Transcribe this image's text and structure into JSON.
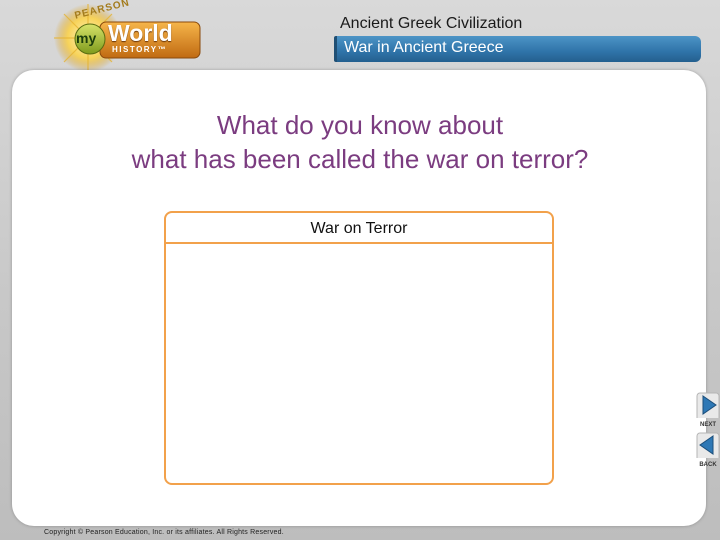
{
  "logo": {
    "brand": "PEARSON",
    "my": "my",
    "world": "World",
    "history": "HISTORY™"
  },
  "header": {
    "unit_title": "Ancient Greek Civilization",
    "lesson_title": "War in Ancient Greece"
  },
  "question": {
    "line1": "What do you know about",
    "line2": "what has been called the war on terror?"
  },
  "organizer": {
    "title": "War on Terror",
    "body": ""
  },
  "nav": {
    "next_label": "NEXT",
    "back_label": "BACK"
  },
  "footer": {
    "copyright": "Copyright © Pearson Education, Inc. or its affiliates. All Rights Reserved."
  },
  "colors": {
    "question_text": "#7b3c80",
    "organizer_border": "#f2a14b",
    "lesson_bar": "#2f74a9",
    "nav_arrow": "#2e78b5"
  }
}
